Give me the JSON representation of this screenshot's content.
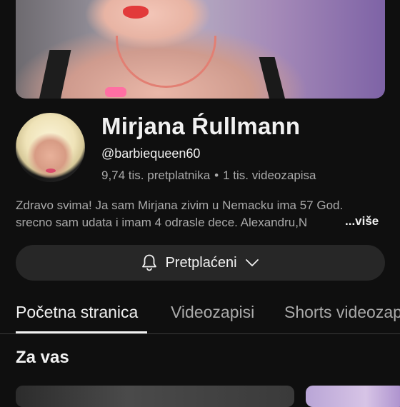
{
  "channel": {
    "name": "Mirjana Ŕullmann",
    "handle": "@barbiequeen60",
    "subscribers": "9,74 tis. pretplatnika",
    "separator": "•",
    "videos": "1 tis. videozapisa",
    "description_line1": "Zdravo svima! Ja sam Mirjana zivim u Nemacku ima 57 God.",
    "description_line2": "srecno sam udata i imam 4 odrasle dece. Alexandru,N",
    "more_label": "...više"
  },
  "subscribe": {
    "label": "Pretplaćeni",
    "icon": "bell-icon",
    "dropdown_icon": "chevron-down-icon"
  },
  "tabs": [
    {
      "label": "Početna stranica",
      "active": true
    },
    {
      "label": "Videozapisi",
      "active": false
    },
    {
      "label": "Shorts videozapisi",
      "active": false
    }
  ],
  "section": {
    "title": "Za vas"
  },
  "colors": {
    "background": "#0f0f0f",
    "primary_text": "#f1f1f1",
    "secondary_text": "#aaaaaa",
    "button_bg": "#272727"
  }
}
